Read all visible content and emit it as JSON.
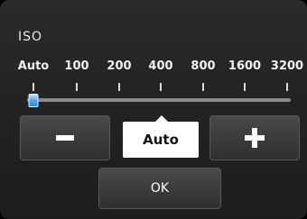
{
  "setting": {
    "title": "ISO"
  },
  "scale": {
    "labels": [
      "Auto",
      "100",
      "200",
      "400",
      "800",
      "1600",
      "3200"
    ]
  },
  "slider": {
    "selected_index": 0,
    "min_index": 0,
    "max_index": 6
  },
  "current_value": "Auto",
  "buttons": {
    "minus_icon": "minus-icon",
    "plus_icon": "plus-icon",
    "ok_label": "OK"
  },
  "colors": {
    "thumb": "#4aa7ff",
    "track": "#8a8a8a",
    "value_box": "#ffffff"
  }
}
